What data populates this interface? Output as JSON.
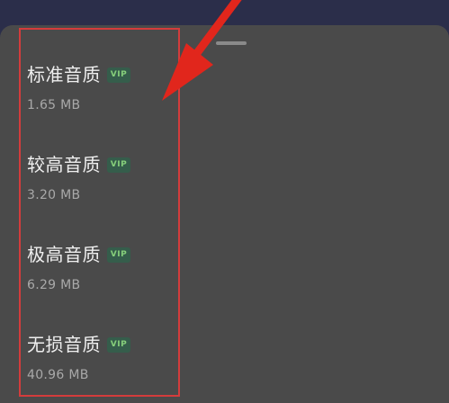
{
  "quality_options": [
    {
      "label": "标准音质",
      "badge": "VIP",
      "size": "1.65 MB"
    },
    {
      "label": "较高音质",
      "badge": "VIP",
      "size": "3.20 MB"
    },
    {
      "label": "极高音质",
      "badge": "VIP",
      "size": "6.29 MB"
    },
    {
      "label": "无损音质",
      "badge": "VIP",
      "size": "40.96 MB"
    }
  ],
  "colors": {
    "sheet_background": "#4a4a4a",
    "top_background": "#2b2e4a",
    "highlight": "#d43c3c",
    "vip_badge_background": "#355d4b",
    "vip_badge_text": "#86cf7b"
  },
  "icons": {
    "annotation": "red-arrow-icon"
  }
}
